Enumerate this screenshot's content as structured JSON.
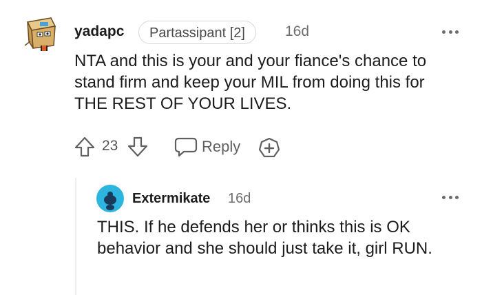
{
  "comment": {
    "username": "yadapc",
    "flair": "Partassipant [2]",
    "time": "16d",
    "body": "NTA and this is your and your fiance's chance to stand firm and keep your MIL from doing this for THE REST OF YOUR LIVES.",
    "votes": "23",
    "reply_label": "Reply",
    "icons": [
      "upvote-icon",
      "downvote-icon",
      "reply-bubble-icon",
      "award-icon",
      "more-options-icon"
    ]
  },
  "reply": {
    "username": "Extermikate",
    "time": "16d",
    "body": "THIS. If he defends her or thinks this is OK behavior and she should just take it, girl RUN.",
    "avatar_color": "#2db5e0"
  },
  "colors": {
    "text": "#1c1c1c",
    "meta": "#6e6e6e",
    "icon": "#5f5f5f",
    "thread_line": "#ececec"
  }
}
